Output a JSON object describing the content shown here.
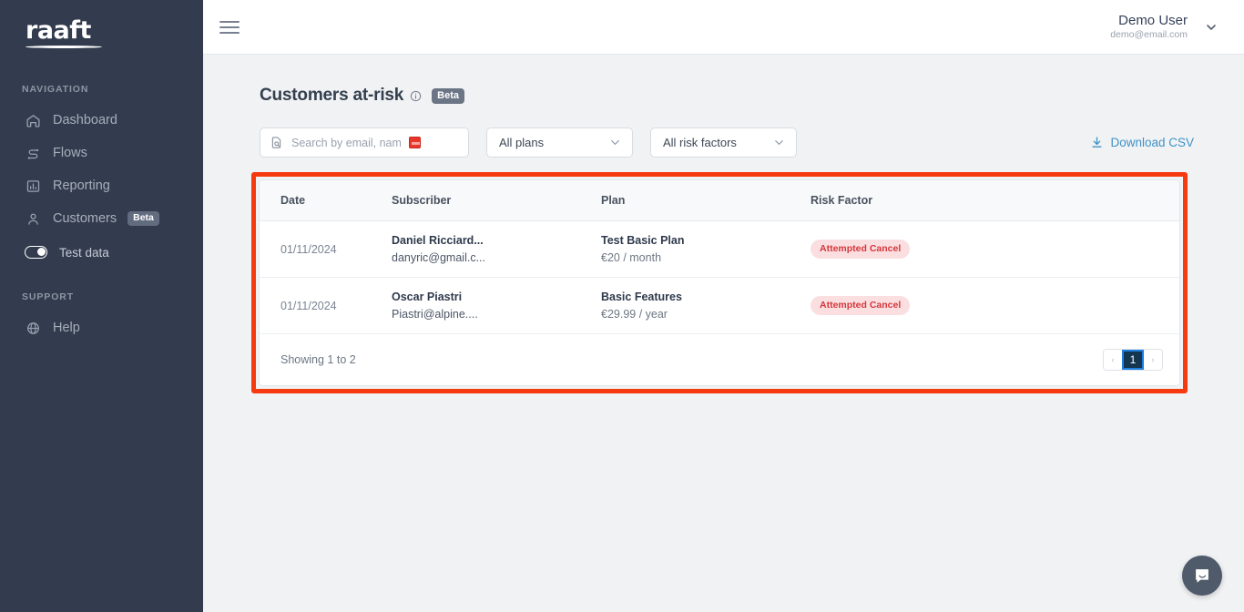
{
  "sidebar": {
    "logo": "raaft",
    "nav_label": "NAVIGATION",
    "items": [
      {
        "label": "Dashboard",
        "icon": "home-icon"
      },
      {
        "label": "Flows",
        "icon": "flow-icon"
      },
      {
        "label": "Reporting",
        "icon": "bar-chart-icon"
      },
      {
        "label": "Customers",
        "icon": "person-icon",
        "badge": "Beta"
      }
    ],
    "toggle": {
      "label": "Test data",
      "state": "on"
    },
    "support_label": "SUPPORT",
    "support_items": [
      {
        "label": "Help",
        "icon": "globe-help-icon"
      }
    ]
  },
  "topbar": {
    "menu_icon": "hamburger-icon",
    "user_name": "Demo User",
    "user_email": "demo@email.com",
    "chevron_icon": "chevron-down-icon"
  },
  "page": {
    "title": "Customers at-risk",
    "info_icon": "info-circle-icon",
    "beta_badge": "Beta"
  },
  "controls": {
    "search": {
      "icon": "document-search-icon",
      "placeholder": "Search by email, name",
      "value": "",
      "marker_color": "#e8372a"
    },
    "plan_filter": {
      "value": "All plans",
      "chevron_icon": "chevron-down-icon"
    },
    "risk_filter": {
      "value": "All risk factors",
      "chevron_icon": "chevron-down-icon"
    },
    "download": {
      "label": "Download CSV",
      "icon": "download-icon",
      "color": "#3e93c6"
    }
  },
  "table": {
    "headers": [
      "Date",
      "Subscriber",
      "Plan",
      "Risk Factor"
    ],
    "rows": [
      {
        "date": "01/11/2024",
        "subscriber_name": "Daniel Ricciard...",
        "subscriber_email": "danyric@gmail.c...",
        "plan_name": "Test Basic Plan",
        "plan_price": "€20 / month",
        "risk": "Attempted Cancel"
      },
      {
        "date": "01/11/2024",
        "subscriber_name": "Oscar Piastri",
        "subscriber_email": "Piastri@alpine....",
        "plan_name": "Basic Features",
        "plan_price": "€29.99 / year",
        "risk": "Attempted Cancel"
      }
    ],
    "footer": {
      "showing": "Showing 1 to 2",
      "prev": "‹",
      "page": "1",
      "next": "›"
    },
    "highlight_color": "#f63a10"
  },
  "chat": {
    "icon": "chat-bubble-icon"
  }
}
